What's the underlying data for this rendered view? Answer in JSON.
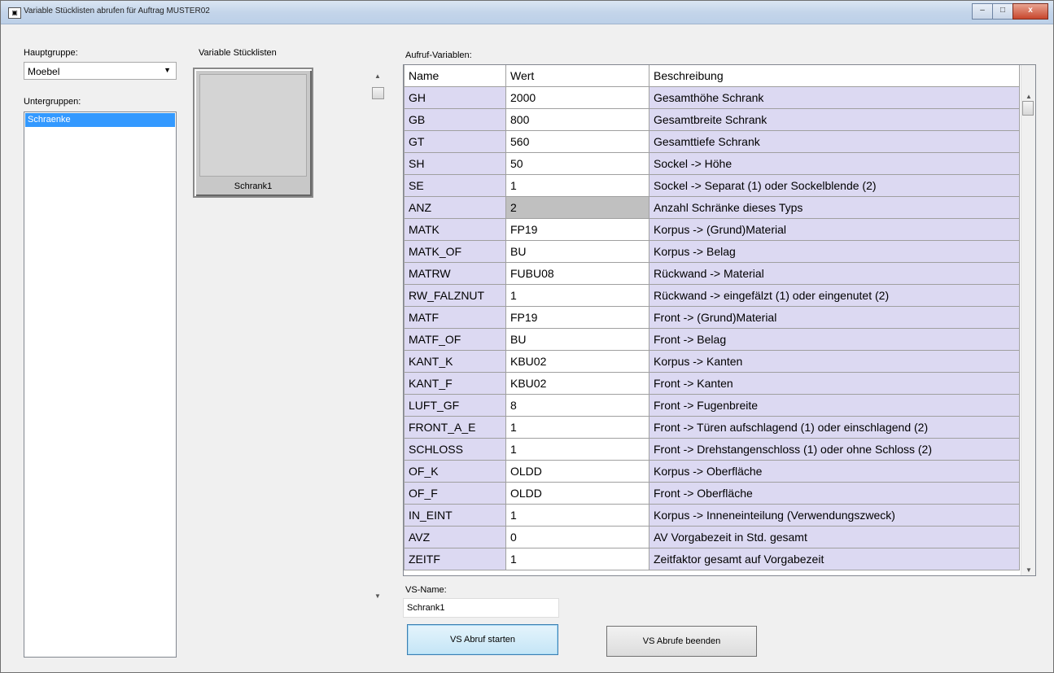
{
  "window": {
    "title": "Variable Stücklisten abrufen für Auftrag MUSTER02",
    "icon": "app-icon",
    "minimize": "–",
    "maximize": "□",
    "close": "x"
  },
  "left": {
    "hauptgruppe_label": "Hauptgruppe:",
    "hauptgruppe_value": "Moebel",
    "untergruppen_label": "Untergruppen:",
    "untergruppen_items": [
      "Schraenke"
    ]
  },
  "middle": {
    "label": "Variable Stücklisten",
    "tiles": [
      "Schrank1"
    ]
  },
  "grid": {
    "label": "Aufruf-Variablen:",
    "headers": [
      "Name",
      "Wert",
      "Beschreibung"
    ],
    "rows": [
      [
        "GH",
        "2000",
        "Gesamthöhe Schrank"
      ],
      [
        "GB",
        "800",
        "Gesamtbreite Schrank"
      ],
      [
        "GT",
        "560",
        "Gesamttiefe Schrank"
      ],
      [
        "SH",
        "50",
        "Sockel -> Höhe"
      ],
      [
        "SE",
        "1",
        "Sockel -> Separat (1) oder Sockelblende (2)"
      ],
      [
        "ANZ",
        "2",
        "Anzahl Schränke dieses Typs"
      ],
      [
        "MATK",
        "FP19",
        "Korpus -> (Grund)Material"
      ],
      [
        "MATK_OF",
        "BU",
        "Korpus -> Belag"
      ],
      [
        "MATRW",
        "FUBU08",
        "Rückwand -> Material"
      ],
      [
        "RW_FALZNUT",
        "1",
        "Rückwand -> eingefälzt (1) oder eingenutet (2)"
      ],
      [
        "MATF",
        "FP19",
        "Front -> (Grund)Material"
      ],
      [
        "MATF_OF",
        "BU",
        "Front -> Belag"
      ],
      [
        "KANT_K",
        "KBU02",
        "Korpus -> Kanten"
      ],
      [
        "KANT_F",
        "KBU02",
        "Front -> Kanten"
      ],
      [
        "LUFT_GF",
        "8",
        "Front -> Fugenbreite"
      ],
      [
        "FRONT_A_E",
        "1",
        "Front -> Türen aufschlagend (1) oder einschlagend (2)"
      ],
      [
        "SCHLOSS",
        "1",
        "Front -> Drehstangenschloss (1) oder ohne Schloss (2)"
      ],
      [
        "OF_K",
        "OLDD",
        "Korpus -> Oberfläche"
      ],
      [
        "OF_F",
        "OLDD",
        "Front -> Oberfläche"
      ],
      [
        "IN_EINT",
        "1",
        "Korpus -> Inneneinteilung (Verwendungszweck)"
      ],
      [
        "AVZ",
        "0",
        "AV Vorgabezeit in Std. gesamt"
      ],
      [
        "ZEITF",
        "1",
        "Zeitfaktor gesamt auf Vorgabezeit"
      ]
    ],
    "selected_row": 5
  },
  "bottom": {
    "vsname_label": "VS-Name:",
    "vsname_value": "Schrank1",
    "start_button": "VS Abruf starten",
    "end_button": "VS Abrufe beenden"
  }
}
